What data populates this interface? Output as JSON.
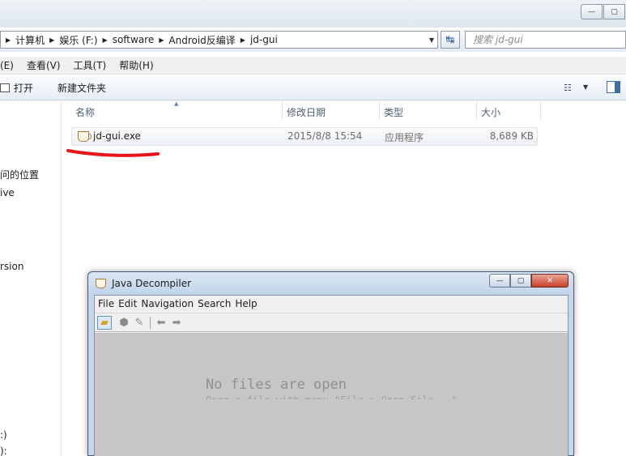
{
  "explorer": {
    "window_controls": {
      "minimize": "—",
      "maximize": "▢"
    },
    "address": {
      "crumbs": [
        "计算机",
        "娱乐 (F:)",
        "software",
        "Android反编译",
        "jd-gui"
      ],
      "dropdown": "▼"
    },
    "refresh_icon": "refresh-icon",
    "search": {
      "placeholder": "搜索 jd-gui"
    },
    "menu": [
      "(E)",
      "查看(V)",
      "工具(T)",
      "帮助(H)"
    ],
    "toolbar": {
      "open_label": "打开",
      "new_folder_label": "新建文件夹",
      "view_icon": "☷"
    },
    "nav": [
      "问的位置",
      "ive",
      "rsion",
      ":)",
      "):"
    ],
    "columns": {
      "name": "名称",
      "date": "修改日期",
      "type": "类型",
      "size": "大小"
    },
    "files": [
      {
        "name": "jd-gui.exe",
        "date": "2015/8/8 15:54",
        "type": "应用程序",
        "size": "8,689 KB"
      }
    ],
    "annotation_color": "#e8141b"
  },
  "jd": {
    "title": "Java Decompiler",
    "window_controls": {
      "minimize": "—",
      "maximize": "▢",
      "close": "✕"
    },
    "menu": [
      "File",
      "Edit",
      "Navigation",
      "Search",
      "Help"
    ],
    "empty_message": "No files are open",
    "hint_partial": "Open a file with menu \"File > Open File...\""
  }
}
